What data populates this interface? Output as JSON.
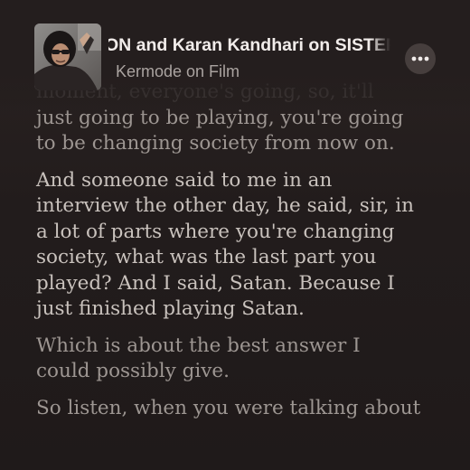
{
  "episode": {
    "title": "ON and Karan Kandhari on SISTER MIDNIGHT",
    "show": "Kermode on Film",
    "artwork_icon": "podcast-artwork-image"
  },
  "menu": {
    "icon": "more-options-icon"
  },
  "transcript": {
    "paragraphs": [
      {
        "lines": [
          "moment, everyone's going, so, it'll",
          "just going to be playing, you're going",
          "to be changing society from now on."
        ]
      },
      {
        "current": true,
        "lines": [
          "And someone said to me in an",
          "interview the other day, he said, sir, in",
          "a lot of parts where you're changing",
          "society, what was the last part you",
          "played? And I said, Satan. Because I",
          "just finished playing Satan."
        ]
      },
      {
        "lines": [
          "Which is about the best answer I",
          "could possibly give."
        ]
      },
      {
        "lines": [
          "So listen, when you were talking about"
        ]
      }
    ]
  },
  "colors": {
    "background": "#241e1e",
    "transcript_text": "#9d9692",
    "current_text": "#c9c2bd",
    "title_text": "#f1ecea",
    "subtitle_text": "#aaa3a0",
    "button_bg": "#463e3d"
  }
}
